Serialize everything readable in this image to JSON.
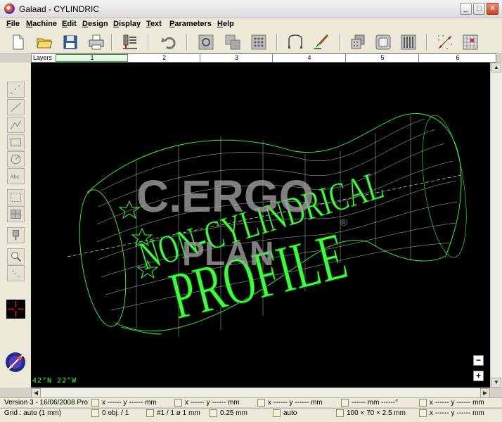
{
  "window": {
    "title": "Galaad  -  CYLINDRIC"
  },
  "menu": [
    "File",
    "Machine",
    "Edit",
    "Design",
    "Display",
    "Text",
    "Parameters",
    "Help"
  ],
  "toolbar": {
    "icons": [
      "new-file-icon",
      "open-folder-icon",
      "save-disk-icon",
      "print-icon",
      "machine-icon",
      "undo-icon",
      "group-icon",
      "ungroup-icon",
      "array-icon",
      "curve-icon",
      "brush-icon",
      "stack-icon",
      "frame-icon",
      "bars-icon",
      "grid-points-icon",
      "grid-icon"
    ]
  },
  "layers": {
    "label": "Layers",
    "tabs": [
      "1",
      "2",
      "3",
      "4",
      "5",
      "6"
    ],
    "active": 0
  },
  "left_tools": [
    "points-tool",
    "line-tool",
    "polyline-tool",
    "rectangle-tool",
    "circle-tool",
    "text-tool",
    "select-tool",
    "grid-select-tool",
    "machine-tool",
    "zoom-tool",
    "pan-tool",
    "crosshair-tool"
  ],
  "canvas": {
    "text_top": "NON-CYLINDRICAL",
    "text_bottom": "PROFILE",
    "watermark_1": "C.ERGO",
    "watermark_2": "PLAN",
    "watermark_reg": "®",
    "readout": "42°N  22°W"
  },
  "zoom": {
    "minus": "−",
    "plus": "+"
  },
  "status": {
    "row1": {
      "version": "Version 3 - 16/06/2008  Pro",
      "c1": "x ------    y ------  mm",
      "c2": "x ------    y ------  mm",
      "c3": "x ------    y ------  mm",
      "c4": "------ mm   ------°",
      "c5": "x ------    y ------  mm"
    },
    "row2": {
      "grid": "Grid :  auto  (1 mm)",
      "objects": "0 obj. / 1",
      "pass": "#1 / 1   ø 1 mm",
      "step": "0.25 mm",
      "speed": "auto",
      "size": "100 × 70 × 2.5 mm",
      "c5": "x ------    y ------  mm"
    }
  },
  "colors": {
    "wire": "#3bff3b",
    "bg": "#000000",
    "accent": "#2ca32c"
  }
}
